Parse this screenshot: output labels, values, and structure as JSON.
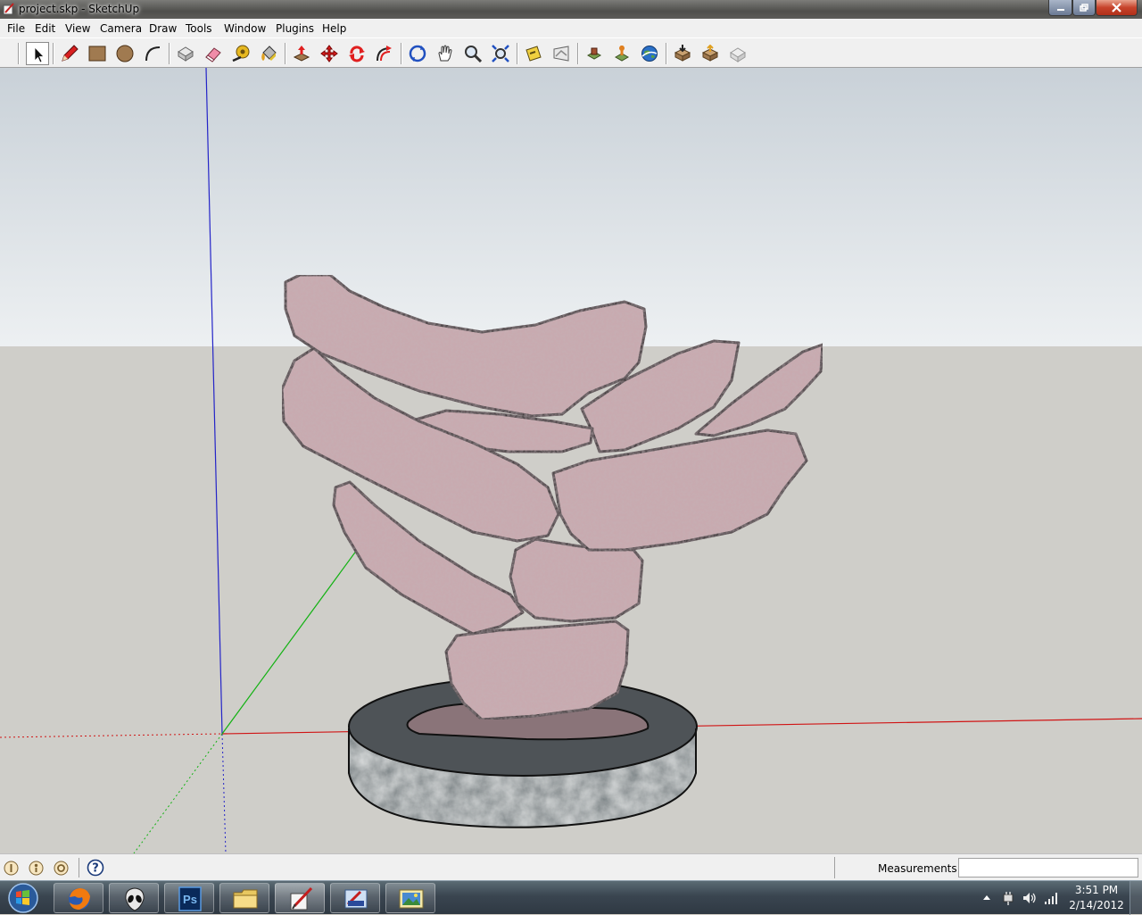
{
  "window": {
    "title": "project.skp - SketchUp"
  },
  "menu": {
    "items": [
      "File",
      "Edit",
      "View",
      "Camera",
      "Draw",
      "Tools",
      "Window",
      "Plugins",
      "Help"
    ]
  },
  "toolbar": {
    "tools": [
      "select-icon",
      "pencil-icon",
      "rectangle-icon",
      "circle-icon",
      "arc-icon",
      "make-component-icon",
      "eraser-icon",
      "tape-measure-icon",
      "paint-bucket-icon",
      "push-pull-icon",
      "move-icon",
      "rotate-icon",
      "offset-icon",
      "orbit-icon",
      "pan-icon",
      "zoom-icon",
      "zoom-extents-icon",
      "section-plane-icon",
      "get-models-icon",
      "share-model-icon",
      "google-earth-toggle-icon",
      "place-model-icon",
      "get-current-view-icon",
      "get-components-icon",
      "share-component-icon",
      "preview-icon"
    ]
  },
  "status": {
    "measurements_label": "Measurements",
    "measurements_value": ""
  },
  "taskbar": {
    "time": "3:51 PM",
    "date": "2/14/2012"
  },
  "colors": {
    "x_axis": "#d01414",
    "y_axis": "#13b213",
    "z_axis": "#2424c8",
    "sky": "#e9eef2",
    "ground": "#cfcec9",
    "stone": "#c9a8ad",
    "base": "#5e6266"
  }
}
